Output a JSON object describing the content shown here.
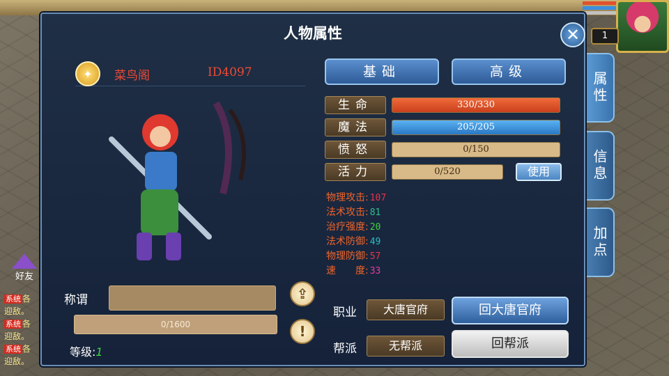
{
  "panel": {
    "title": "人物属性"
  },
  "character": {
    "name": "菜鸟阁",
    "id": "ID4097"
  },
  "tabs": [
    {
      "label": "基础"
    },
    {
      "label": "高级"
    }
  ],
  "side_tabs": [
    {
      "label": "属性"
    },
    {
      "label": "信息"
    },
    {
      "label": "加点"
    }
  ],
  "hud": {
    "level": "1"
  },
  "friends": {
    "label": "好友"
  },
  "chat": {
    "lines": [
      {
        "tag": "系统",
        "text": "各"
      },
      {
        "text": "迎敌。"
      },
      {
        "tag": "系统",
        "text": "各"
      },
      {
        "text": "迎敌。"
      },
      {
        "tag": "系统",
        "text": "各"
      },
      {
        "text": "迎敌。"
      }
    ]
  },
  "stats": [
    {
      "label": "生命",
      "value": "330/330",
      "ratio": 1.0,
      "color": "#e0512d"
    },
    {
      "label": "魔法",
      "value": "205/205",
      "ratio": 1.0,
      "color": "#3a8fe0"
    },
    {
      "label": "愤怒",
      "value": "0/150",
      "ratio": 0
    },
    {
      "label": "活力",
      "value": "0/520",
      "ratio": 0
    }
  ],
  "use_button": "使用",
  "attributes": [
    {
      "label": "物理攻击",
      "value": "107",
      "color": "#e8334a"
    },
    {
      "label": "法术攻击",
      "value": "81",
      "color": "#2fc08a"
    },
    {
      "label": "治疗强度",
      "value": "20",
      "color": "#3fd23f"
    },
    {
      "label": "法术防御",
      "value": "49",
      "color": "#28c0c0"
    },
    {
      "label": "物理防御",
      "value": "57",
      "color": "#e8334a"
    },
    {
      "label": "速　　度",
      "value": "33",
      "color": "#e83aa0"
    }
  ],
  "title_field": {
    "label": "称谓",
    "value": ""
  },
  "experience": {
    "value": "0/1600",
    "ratio": 0
  },
  "level": {
    "label": "等级:",
    "value": "1"
  },
  "profession": {
    "label": "职业",
    "value": "大唐官府",
    "button": "回大唐官府"
  },
  "guild": {
    "label": "帮派",
    "value": "无帮派",
    "button": "回帮派"
  },
  "colors": {
    "accent": "#4a7fb3",
    "name_red": "#f04a35",
    "attr_orange": "#f0642a"
  }
}
